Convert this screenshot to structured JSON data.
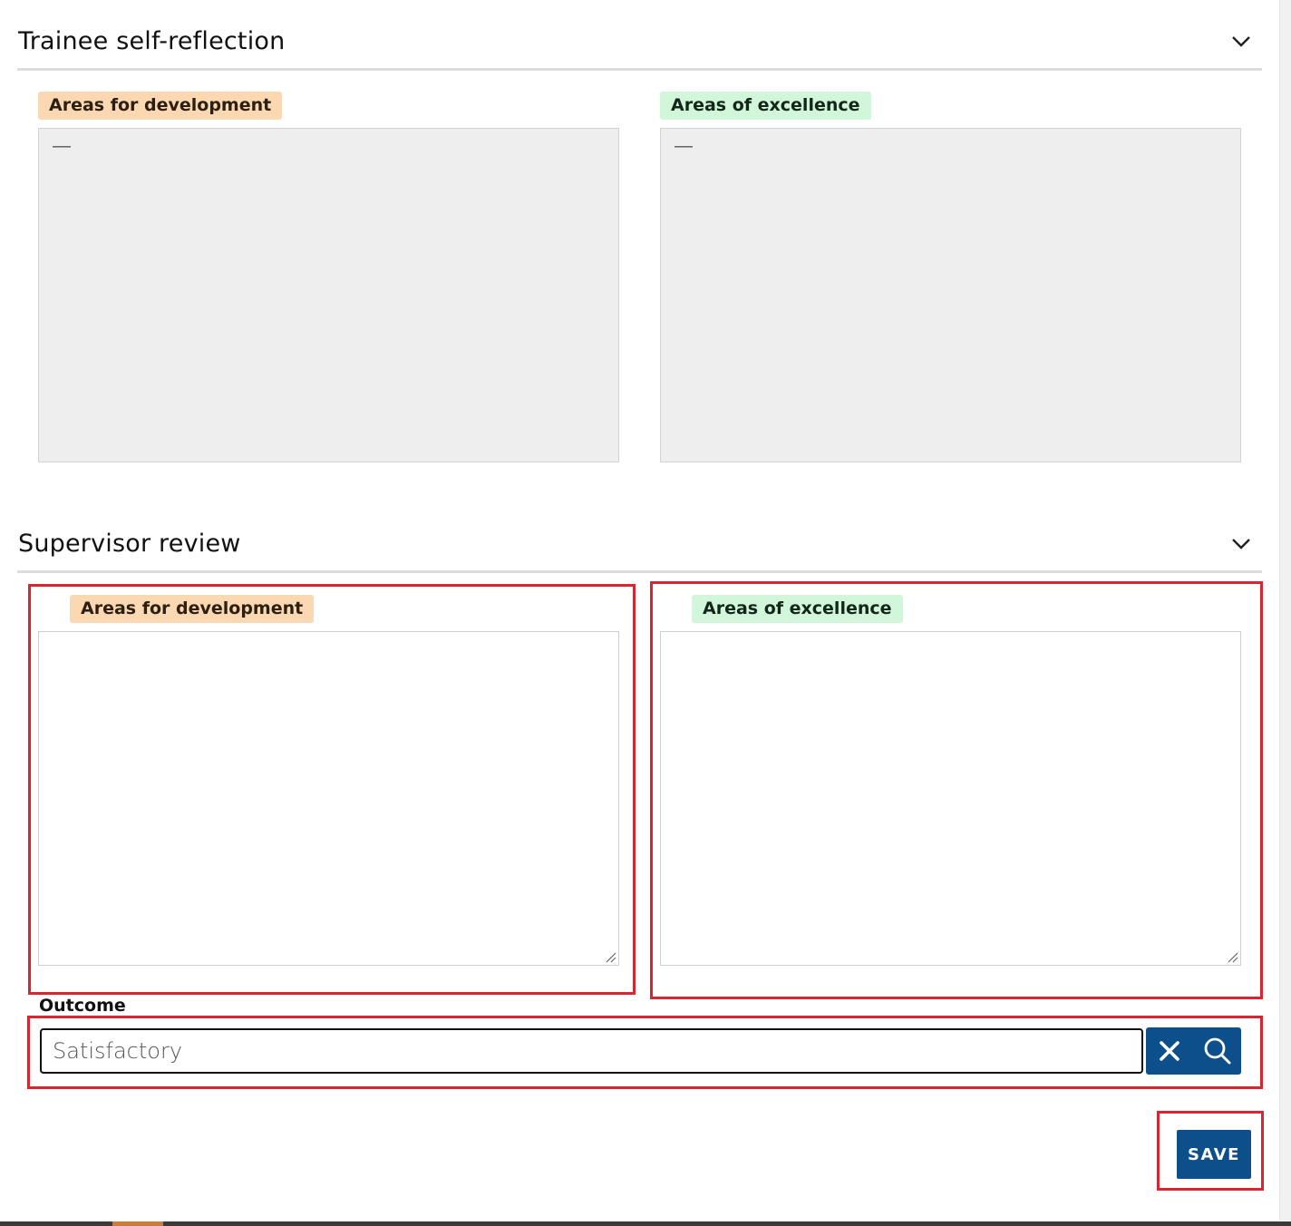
{
  "trainee_section": {
    "title": "Trainee self-reflection",
    "development": {
      "label": "Areas for development",
      "value": "—"
    },
    "excellence": {
      "label": "Areas of excellence",
      "value": "—"
    }
  },
  "supervisor_section": {
    "title": "Supervisor review",
    "development": {
      "label": "Areas for development",
      "value": ""
    },
    "excellence": {
      "label": "Areas of excellence",
      "value": ""
    },
    "outcome": {
      "label": "Outcome",
      "value": "Satisfactory"
    },
    "save_label": "SAVE"
  },
  "colors": {
    "primary": "#0d4f8b",
    "highlight_outline": "#d9252f",
    "badge_development": "#fbd7b2",
    "badge_excellence": "#d2f6da",
    "readonly_background": "#eeeeee"
  },
  "icons": {
    "collapse": "chevron-down-icon",
    "clear": "close-icon",
    "lookup": "search-icon",
    "resize": "resize-grip-icon"
  }
}
